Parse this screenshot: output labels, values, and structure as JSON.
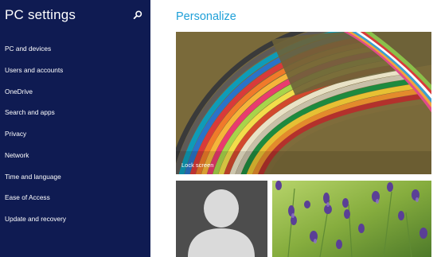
{
  "sidebar": {
    "title": "PC settings",
    "search_icon": "search-icon",
    "items": [
      {
        "label": "PC and devices"
      },
      {
        "label": "Users and accounts"
      },
      {
        "label": "OneDrive"
      },
      {
        "label": "Search and apps"
      },
      {
        "label": "Privacy"
      },
      {
        "label": "Network"
      },
      {
        "label": "Time and language"
      },
      {
        "label": "Ease of Access"
      },
      {
        "label": "Update and recovery"
      }
    ]
  },
  "main": {
    "title": "Personalize",
    "lock_screen": {
      "label": "Lock screen"
    },
    "account_picture": {
      "icon": "person-silhouette-icon"
    },
    "start_background": {
      "icon": "lavender-photo"
    }
  },
  "colors": {
    "sidebar_bg": "#0f1b52",
    "accent": "#1fa0d8",
    "account_tile_bg": "#4d4d4d"
  }
}
